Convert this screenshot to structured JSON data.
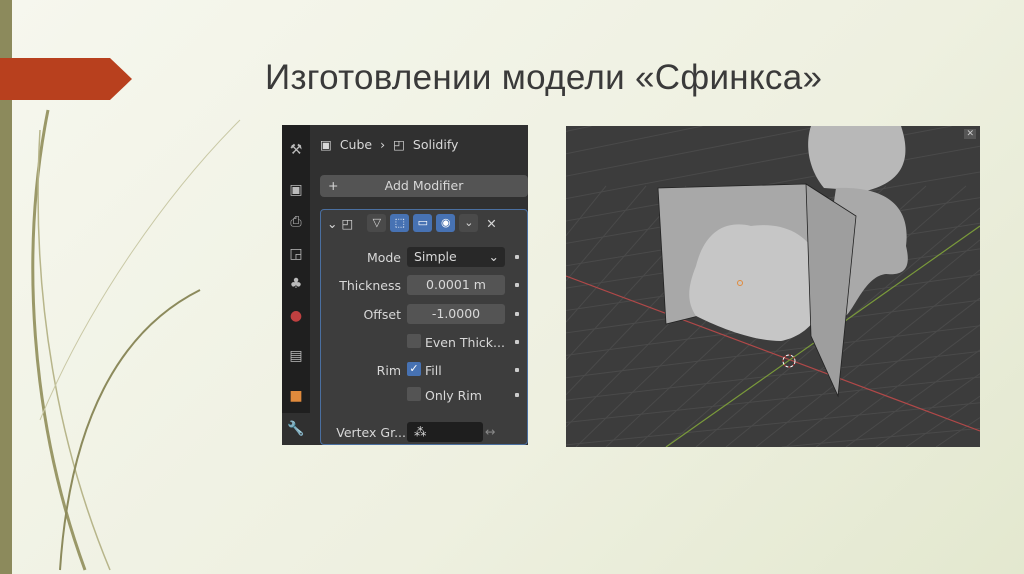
{
  "slide": {
    "title": "Изготовлении модели «Сфинкса»"
  },
  "panel": {
    "breadcrumb": {
      "object": "Cube",
      "modifier": "Solidify"
    },
    "add_modifier": "Add Modifier",
    "fields": {
      "mode_label": "Mode",
      "mode_value": "Simple",
      "thickness_label": "Thickness",
      "thickness_value": "0.0001 m",
      "offset_label": "Offset",
      "offset_value": "-1.0000",
      "even_thickness": "Even Thick...",
      "rim_label": "Rim",
      "fill": "Fill",
      "only_rim": "Only Rim",
      "vertex_group_label": "Vertex Gr..."
    },
    "checks": {
      "even_thickness": false,
      "fill": true,
      "only_rim": false
    }
  },
  "colors": {
    "accent": "#4772b3",
    "banner": "#b8401e",
    "x_axis": "#c0504d",
    "y_axis": "#7a9a3a"
  }
}
